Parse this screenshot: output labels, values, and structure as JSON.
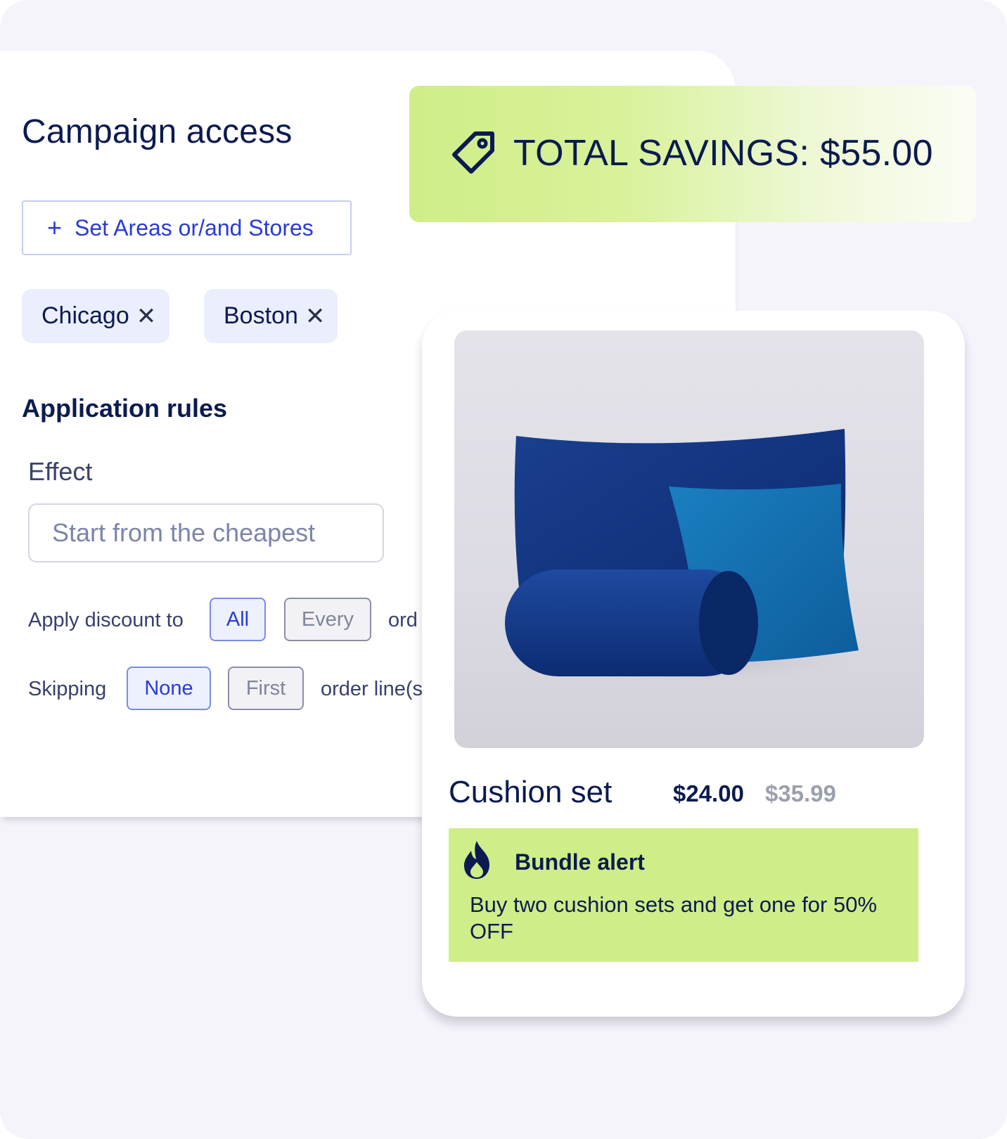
{
  "campaign": {
    "title": "Campaign access",
    "set_areas_label": "Set Areas or/and Stores",
    "locations": [
      "Chicago",
      "Boston"
    ],
    "remove_glyph": "✕"
  },
  "rules": {
    "title": "Application rules",
    "effect_label": "Effect",
    "effect_placeholder": "Start from the cheapest",
    "apply_label": "Apply discount to",
    "apply_options": [
      "All",
      "Every"
    ],
    "apply_selected": "All",
    "apply_suffix": "ord",
    "skip_label": "Skipping",
    "skip_options": [
      "None",
      "First"
    ],
    "skip_selected": "None",
    "skip_suffix": "order line(s"
  },
  "savings": {
    "label": "TOTAL SAVINGS: $55.00",
    "icon": "tag-icon"
  },
  "product": {
    "name": "Cushion set",
    "price": "$24.00",
    "original_price": "$35.99",
    "bundle_title": "Bundle alert",
    "bundle_text": "Buy two cushion sets and get one for 50% OFF",
    "bundle_icon": "flame-icon"
  },
  "colors": {
    "navy": "#0b1b4f",
    "accent_blue": "#2a3bd6",
    "lime": "#cfed88",
    "background": "#f6f4fb"
  }
}
